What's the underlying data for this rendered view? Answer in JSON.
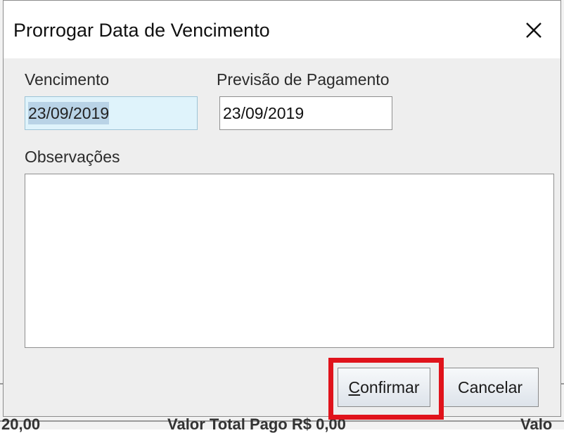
{
  "dialog": {
    "title": "Prorrogar Data de Vencimento",
    "close_label": "X"
  },
  "fields": {
    "vencimento": {
      "label": "Vencimento",
      "value": "23/09/2019"
    },
    "previsao": {
      "label": "Previsão de Pagamento",
      "value": "23/09/2019"
    },
    "observacoes": {
      "label": "Observações",
      "value": ""
    }
  },
  "buttons": {
    "confirm": {
      "mnemonic": "C",
      "rest": "onfirmar"
    },
    "cancel": "Cancelar"
  },
  "background": {
    "footer_left": "20,00",
    "footer_middle": "Valor Total Pago R$ 0,00",
    "footer_right": "Valo"
  },
  "colors": {
    "highlight": "#e0131b",
    "focused_field": "#dff3fb",
    "selection": "#b9d3e6"
  }
}
